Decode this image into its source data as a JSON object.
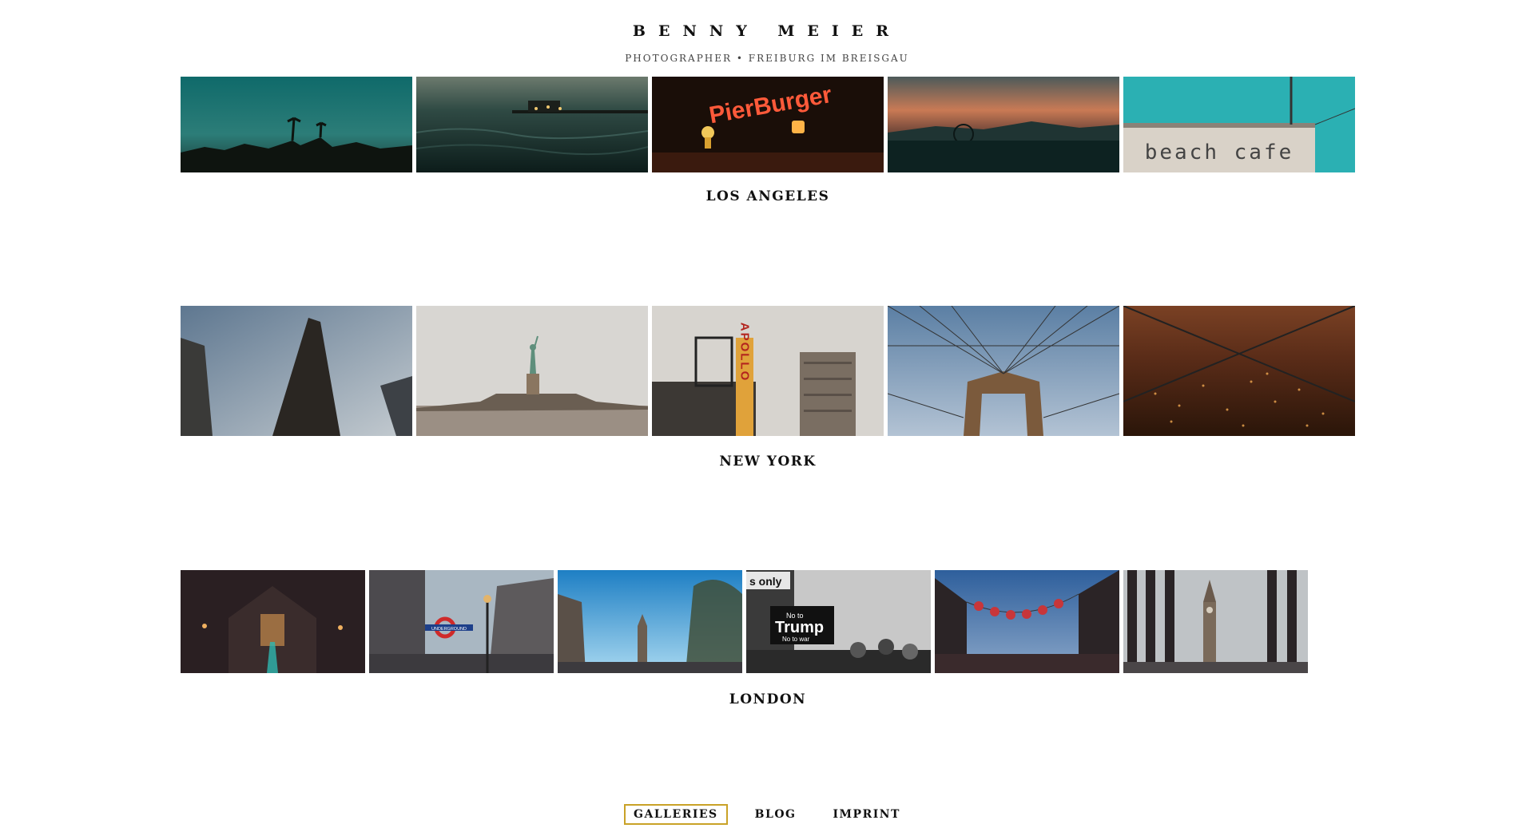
{
  "header": {
    "title": "BENNY MEIER",
    "subtitle": "PHOTOGRAPHER • FREIBURG IM BREISGAU"
  },
  "galleries": [
    {
      "title": "LOS ANGELES"
    },
    {
      "title": "NEW YORK"
    },
    {
      "title": "LONDON"
    }
  ],
  "photo_text": {
    "pier_burger_sign": "PierBurger",
    "beach_cafe_sign": "beach cafe",
    "apollo_sign": "APOLLO",
    "underground_sign": "UNDERGROUND",
    "protest_sign_main": "Trump",
    "protest_sign_no_to": "No to",
    "protest_sign_no_war": "No to war",
    "protest_sign_only": "s only"
  },
  "nav": {
    "items": [
      "GALLERIES",
      "BLOG",
      "IMPRINT"
    ],
    "active": "GALLERIES"
  },
  "colors": {
    "nav_active_border": "#c9a227"
  }
}
